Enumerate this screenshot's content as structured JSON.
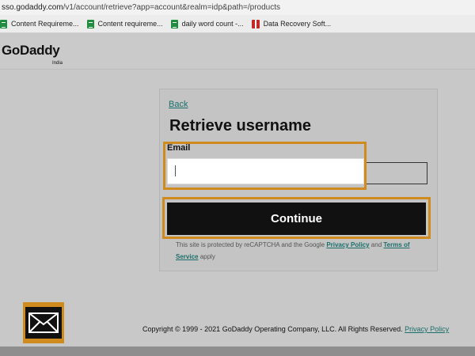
{
  "browser": {
    "url_domain": "sso.godaddy.com",
    "url_path": "/v1/account/retrieve?app=account&realm=idp&path=/products",
    "bookmarks": [
      {
        "label": "Content Requireme...",
        "icon": "sheets-icon"
      },
      {
        "label": "Content requireme...",
        "icon": "sheets-icon"
      },
      {
        "label": "daily word count -...",
        "icon": "sheets-icon"
      },
      {
        "label": "Data Recovery Soft...",
        "icon": "gift-icon"
      }
    ]
  },
  "header": {
    "logo_text": "GoDaddy",
    "logo_sub": "India"
  },
  "form": {
    "back_link": "Back",
    "title": "Retrieve username",
    "email_label": "Email",
    "email_value": "",
    "continue_button": "Continue",
    "recaptcha_prefix": "This site is protected by reCAPTCHA and the Google ",
    "privacy_link": "Privacy Policy",
    "and_text": " and ",
    "terms_link": "Terms of Service",
    "apply_text": " apply"
  },
  "footer": {
    "copyright": "Copyright © 1999 - 2021 GoDaddy Operating Company, LLC. All Rights Reserved. ",
    "privacy_link": "Privacy Policy"
  },
  "colors": {
    "highlight": "#d08b1f",
    "link": "#1a6f6a",
    "button_bg": "#111111"
  }
}
